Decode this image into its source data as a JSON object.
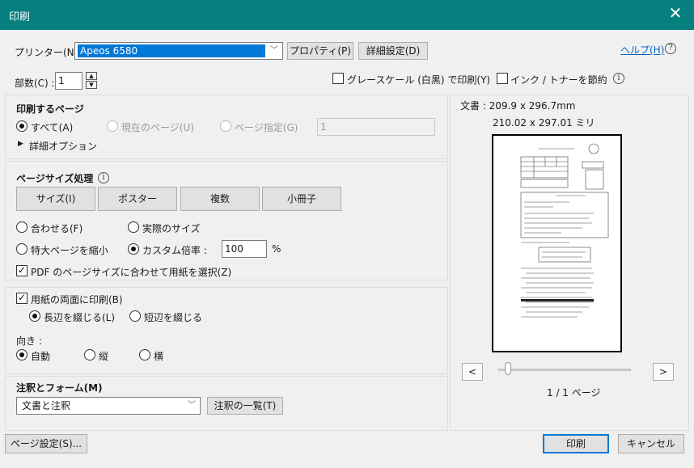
{
  "window": {
    "title": "印刷",
    "close_glyph": "✕"
  },
  "printer": {
    "label": "プリンター(N) :",
    "selected": "Apeos 6580",
    "properties_label": "プロパティ(P)",
    "advanced_label": "詳細設定(D)",
    "help_label": "ヘルプ(H)"
  },
  "copies": {
    "label": "部数(C) :",
    "value": "1"
  },
  "options": {
    "grayscale_label": "グレースケール (白黒) で印刷(Y)",
    "grayscale_checked": false,
    "save_ink_label": "インク / トナーを節約",
    "save_ink_checked": false
  },
  "pages_to_print": {
    "title": "印刷するページ",
    "all_label": "すべて(A)",
    "current_label": "現在のページ(U)",
    "specify_label": "ページ指定(G)",
    "specify_value": "1",
    "more_options_label": "詳細オプション",
    "selected": "all"
  },
  "page_sizing": {
    "title": "ページサイズ処理",
    "tab_size": "サイズ(I)",
    "tab_poster": "ポスター",
    "tab_multiple": "複数",
    "tab_booklet": "小冊子",
    "fit_label": "合わせる(F)",
    "actual_label": "実際のサイズ",
    "shrink_label": "特大ページを縮小",
    "custom_label": "カスタム倍率 :",
    "custom_value": "100",
    "custom_unit": "%",
    "pdf_size_label": "PDF のページサイズに合わせて用紙を選択(Z)",
    "pdf_size_checked": true,
    "selected": "custom"
  },
  "duplex": {
    "label": "用紙の両面に印刷(B)",
    "checked": true,
    "long_edge_label": "長辺を綴じる(L)",
    "short_edge_label": "短辺を綴じる",
    "selected": "long"
  },
  "orientation": {
    "title": "向き :",
    "auto_label": "自動",
    "portrait_label": "縦",
    "landscape_label": "横",
    "selected": "auto"
  },
  "comments": {
    "title": "注釈とフォーム(M)",
    "selected": "文書と注釈",
    "summary_label": "注釈の一覧(T)"
  },
  "preview": {
    "document_label": "文書 : 209.9 x 296.7mm",
    "paper_size": "210.02 x 297.01 ミリ",
    "prev_glyph": "<",
    "next_glyph": ">",
    "page_indicator": "1 / 1 ページ"
  },
  "footer": {
    "page_setup_label": "ページ設定(S)...",
    "print_label": "印刷",
    "cancel_label": "キャンセル"
  },
  "colors": {
    "titlebar": "#06807e",
    "accent": "#0078d7"
  }
}
